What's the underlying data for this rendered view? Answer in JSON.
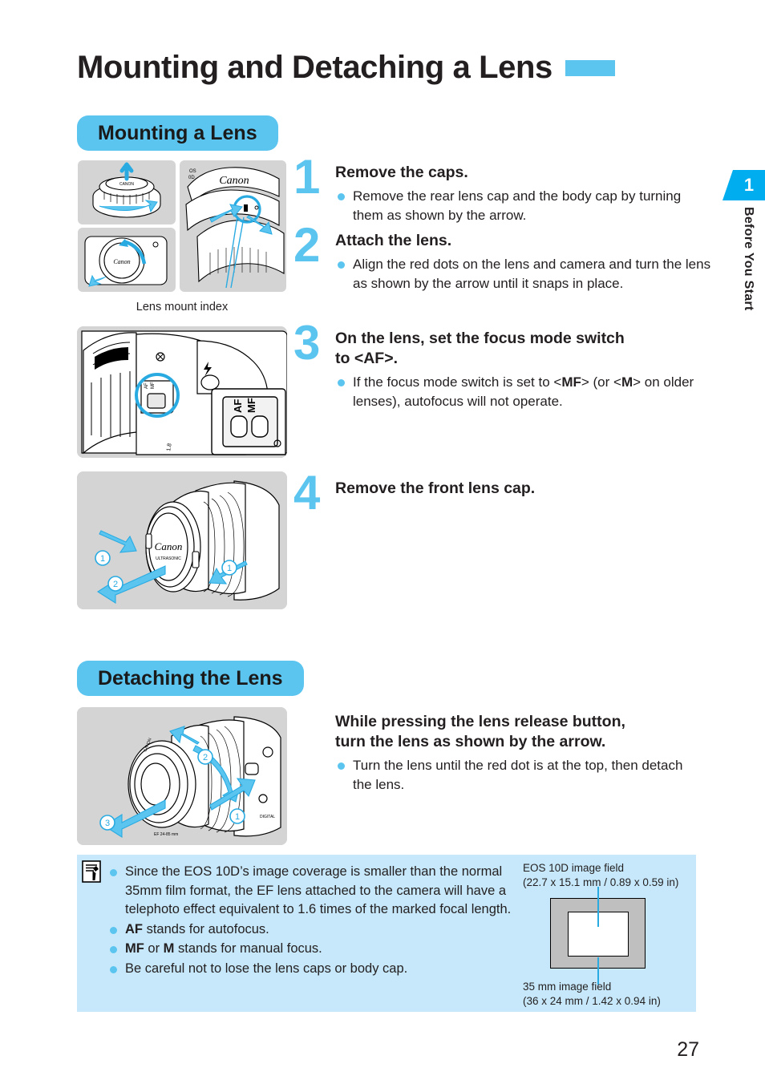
{
  "page": {
    "title": "Mounting and Detaching a Lens",
    "number": "27"
  },
  "side_tab": {
    "chapter_number": "1",
    "chapter_label": "Before You Start"
  },
  "sections": {
    "mounting": {
      "pill_label": "Mounting a Lens",
      "illustration_caption": "Lens mount index",
      "steps": [
        {
          "number": "1",
          "heading": "Remove the caps.",
          "bullet": "Remove the rear lens cap and the body cap by turning them as shown by the arrow."
        },
        {
          "number": "2",
          "heading": "Attach the lens.",
          "bullet": "Align the red dots on the lens and camera and turn the lens as shown by the arrow until it snaps in place."
        },
        {
          "number": "3",
          "heading_line1": "On the lens, set the focus mode switch",
          "heading_line2": "to <AF>.",
          "bullet_pre": "If the focus mode switch is set to <",
          "bullet_mf": "MF",
          "bullet_mid": "> (or <",
          "bullet_m": "M",
          "bullet_post": "> on older lenses), autofocus will not operate."
        },
        {
          "number": "4",
          "heading": "Remove the front lens cap."
        }
      ]
    },
    "detaching": {
      "pill_label": "Detaching the Lens",
      "step": {
        "heading_line1": "While pressing the lens release button,",
        "heading_line2": "turn the lens as shown by the arrow.",
        "bullet": "Turn the lens until the red dot is at the top, then detach the lens."
      }
    }
  },
  "note_box": {
    "items": [
      {
        "text": "Since the EOS 10D’s image coverage is smaller than the normal 35mm film format, the EF lens attached to the camera will have a telephoto effect equivalent to 1.6 times of the marked focal length."
      },
      {
        "bold": "AF",
        "text": " stands for autofocus."
      },
      {
        "bold": "MF",
        "mid": " or ",
        "bold2": "M",
        "text": " stands for manual focus."
      },
      {
        "text": "Be careful not to lose the lens caps or body cap."
      }
    ],
    "field_diagram": {
      "top_label_line1": "EOS 10D image field",
      "top_label_line2": "(22.7 x 15.1 mm / 0.89 x 0.59 in)",
      "bottom_label_line1": "35 mm image field",
      "bottom_label_line2": "(36 x 24 mm / 1.42 x 0.94 in)"
    }
  },
  "colors": {
    "accent_blue": "#5bc5f0",
    "tab_blue": "#00aeef",
    "note_bg": "#c6e8fa",
    "illustration_bg": "#d4d4d4",
    "text": "#231f20"
  }
}
